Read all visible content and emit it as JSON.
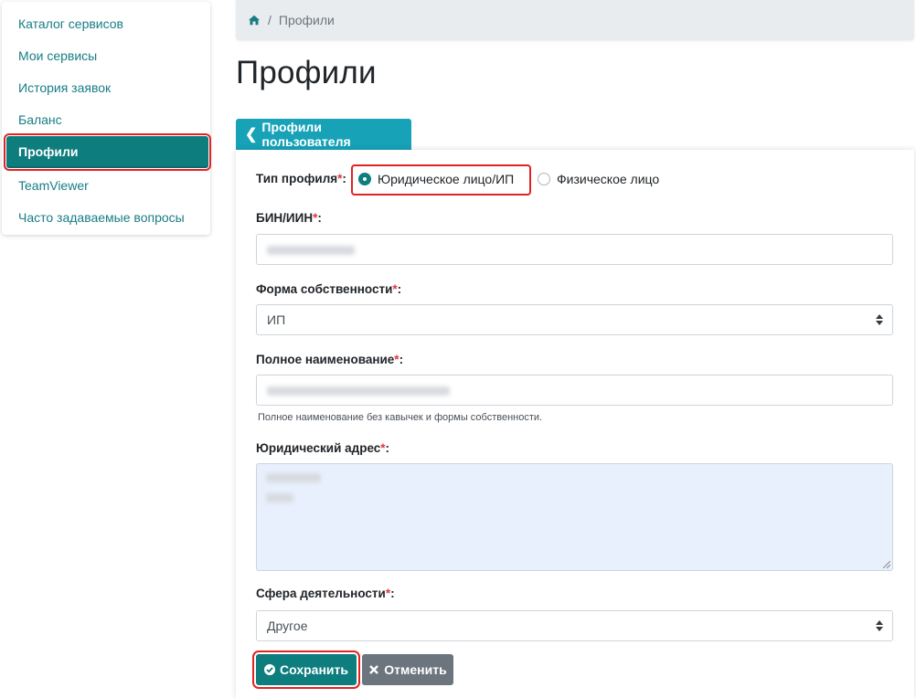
{
  "sidebar": {
    "items": [
      {
        "label": "Каталог сервисов"
      },
      {
        "label": "Мои сервисы"
      },
      {
        "label": "История заявок"
      },
      {
        "label": "Баланс"
      },
      {
        "label": "Профили",
        "active": true
      },
      {
        "label": "TeamViewer"
      },
      {
        "label": "Часто задаваемые вопросы"
      }
    ]
  },
  "breadcrumb": {
    "sep": "/",
    "current": "Профили",
    "home_icon": "home-icon"
  },
  "page": {
    "title": "Профили"
  },
  "back_button": {
    "label": "Профили пользователя",
    "icon": "chevron-left-icon"
  },
  "form": {
    "profile_type": {
      "label": "Тип профиля",
      "required_mark": "*",
      "suffix": ":",
      "options": [
        {
          "label": "Юридическое лицо/ИП",
          "checked": true
        },
        {
          "label": "Физическое лицо",
          "checked": false
        }
      ]
    },
    "bin": {
      "label": "БИН/ИИН",
      "required_mark": "*",
      "suffix": ":"
    },
    "ownership": {
      "label": "Форма собственности",
      "required_mark": "*",
      "suffix": ":",
      "value": "ИП"
    },
    "full_name": {
      "label": "Полное наименование",
      "required_mark": "*",
      "suffix": ":",
      "hint": "Полное наименование без кавычек и формы собственности."
    },
    "legal_address": {
      "label": "Юридический адрес",
      "required_mark": "*",
      "suffix": ":"
    },
    "activity": {
      "label": "Сфера деятельности",
      "required_mark": "*",
      "suffix": ":",
      "value": "Другое"
    }
  },
  "actions": {
    "save": {
      "label": "Сохранить",
      "icon": "check-circle-icon"
    },
    "cancel": {
      "label": "Отменить",
      "icon": "times-icon"
    }
  },
  "colors": {
    "accent": "#0e7d7e",
    "link": "#177d85",
    "info": "#17a2b8",
    "highlight": "#e02424"
  }
}
